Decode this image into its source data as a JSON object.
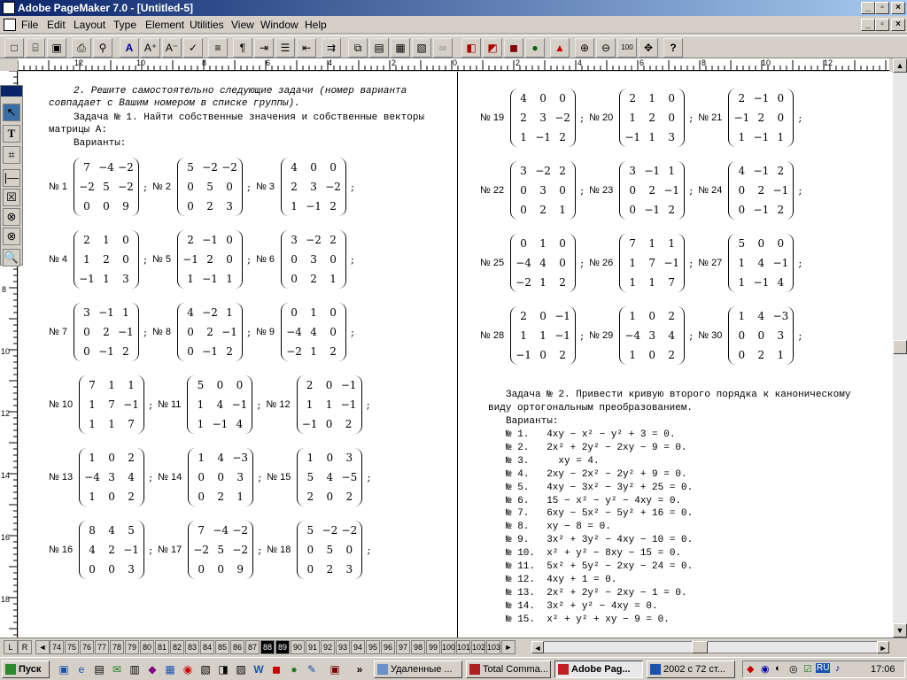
{
  "window": {
    "title": "Adobe PageMaker 7.0 - [Untitled-5]"
  },
  "menu": [
    "File",
    "Edit",
    "Layout",
    "Type",
    "Element",
    "Utilities",
    "View",
    "Window",
    "Help"
  ],
  "ruler": {
    "top_labels": [
      "12",
      "10",
      "8",
      "6",
      "4",
      "2",
      "0",
      "2",
      "4",
      "6",
      "8",
      "10",
      "12"
    ],
    "left_labels": [
      "8",
      "10",
      "12",
      "14",
      "16",
      "18"
    ]
  },
  "left_col": {
    "intro": [
      "2. Решите самостоятельно следующие задачи (номер варианта",
      "совпадает с Вашим номером в списке группы)."
    ],
    "task1": [
      "Задача № 1. Найти собственные значения и собственные векторы",
      "матрицы A:"
    ],
    "variants_label": "Варианты:",
    "rows": [
      {
        "items": [
          {
            "label": "№ 1",
            "m": [
              [
                "7",
                "−4",
                "−2"
              ],
              [
                "−2",
                "5",
                "−2"
              ],
              [
                "0",
                "0",
                "9"
              ]
            ]
          },
          {
            "label": "№ 2",
            "m": [
              [
                "5",
                "−2",
                "−2"
              ],
              [
                "0",
                "5",
                "0"
              ],
              [
                "0",
                "2",
                "3"
              ]
            ]
          },
          {
            "label": "№ 3",
            "m": [
              [
                "4",
                "0",
                "0"
              ],
              [
                "2",
                "3",
                "−2"
              ],
              [
                "1",
                "−1",
                "2"
              ]
            ]
          }
        ]
      },
      {
        "items": [
          {
            "label": "№ 4",
            "m": [
              [
                "2",
                "1",
                "0"
              ],
              [
                "1",
                "2",
                "0"
              ],
              [
                "−1",
                "1",
                "3"
              ]
            ]
          },
          {
            "label": "№ 5",
            "m": [
              [
                "2",
                "−1",
                "0"
              ],
              [
                "−1",
                "2",
                "0"
              ],
              [
                "1",
                "−1",
                "1"
              ]
            ]
          },
          {
            "label": "№ 6",
            "m": [
              [
                "3",
                "−2",
                "2"
              ],
              [
                "0",
                "3",
                "0"
              ],
              [
                "0",
                "2",
                "1"
              ]
            ]
          }
        ]
      },
      {
        "items": [
          {
            "label": "№ 7",
            "m": [
              [
                "3",
                "−1",
                "1"
              ],
              [
                "0",
                "2",
                "−1"
              ],
              [
                "0",
                "−1",
                "2"
              ]
            ]
          },
          {
            "label": "№ 8",
            "m": [
              [
                "4",
                "−2",
                "1"
              ],
              [
                "0",
                "2",
                "−1"
              ],
              [
                "0",
                "−1",
                "2"
              ]
            ]
          },
          {
            "label": "№ 9",
            "m": [
              [
                "0",
                "1",
                "0"
              ],
              [
                "−4",
                "4",
                "0"
              ],
              [
                "−2",
                "1",
                "2"
              ]
            ]
          }
        ]
      },
      {
        "items": [
          {
            "label": "№ 10",
            "m": [
              [
                "7",
                "1",
                "1"
              ],
              [
                "1",
                "7",
                "−1"
              ],
              [
                "1",
                "1",
                "7"
              ]
            ]
          },
          {
            "label": "№ 11",
            "m": [
              [
                "5",
                "0",
                "0"
              ],
              [
                "1",
                "4",
                "−1"
              ],
              [
                "1",
                "−1",
                "4"
              ]
            ]
          },
          {
            "label": "№ 12",
            "m": [
              [
                "2",
                "0",
                "−1"
              ],
              [
                "1",
                "1",
                "−1"
              ],
              [
                "−1",
                "0",
                "2"
              ]
            ]
          }
        ]
      },
      {
        "items": [
          {
            "label": "№ 13",
            "m": [
              [
                "1",
                "0",
                "2"
              ],
              [
                "−4",
                "3",
                "4"
              ],
              [
                "1",
                "0",
                "2"
              ]
            ]
          },
          {
            "label": "№ 14",
            "m": [
              [
                "1",
                "4",
                "−3"
              ],
              [
                "0",
                "0",
                "3"
              ],
              [
                "0",
                "2",
                "1"
              ]
            ]
          },
          {
            "label": "№ 15",
            "m": [
              [
                "1",
                "0",
                "3"
              ],
              [
                "5",
                "4",
                "−5"
              ],
              [
                "2",
                "0",
                "2"
              ]
            ]
          }
        ]
      },
      {
        "items": [
          {
            "label": "№ 16",
            "m": [
              [
                "8",
                "4",
                "5"
              ],
              [
                "4",
                "2",
                "−1"
              ],
              [
                "0",
                "0",
                "3"
              ]
            ]
          },
          {
            "label": "№ 17",
            "m": [
              [
                "7",
                "−4",
                "−2"
              ],
              [
                "−2",
                "5",
                "−2"
              ],
              [
                "0",
                "0",
                "9"
              ]
            ]
          },
          {
            "label": "№ 18",
            "m": [
              [
                "5",
                "−2",
                "−2"
              ],
              [
                "0",
                "5",
                "0"
              ],
              [
                "0",
                "2",
                "3"
              ]
            ]
          }
        ]
      }
    ]
  },
  "right_col": {
    "rows": [
      {
        "items": [
          {
            "label": "№ 19",
            "m": [
              [
                "4",
                "0",
                "0"
              ],
              [
                "2",
                "3",
                "−2"
              ],
              [
                "1",
                "−1",
                "2"
              ]
            ]
          },
          {
            "label": "№ 20",
            "m": [
              [
                "2",
                "1",
                "0"
              ],
              [
                "1",
                "2",
                "0"
              ],
              [
                "−1",
                "1",
                "3"
              ]
            ]
          },
          {
            "label": "№ 21",
            "m": [
              [
                "2",
                "−1",
                "0"
              ],
              [
                "−1",
                "2",
                "0"
              ],
              [
                "1",
                "−1",
                "1"
              ]
            ]
          }
        ]
      },
      {
        "items": [
          {
            "label": "№ 22",
            "m": [
              [
                "3",
                "−2",
                "2"
              ],
              [
                "0",
                "3",
                "0"
              ],
              [
                "0",
                "2",
                "1"
              ]
            ]
          },
          {
            "label": "№ 23",
            "m": [
              [
                "3",
                "−1",
                "1"
              ],
              [
                "0",
                "2",
                "−1"
              ],
              [
                "0",
                "−1",
                "2"
              ]
            ]
          },
          {
            "label": "№ 24",
            "m": [
              [
                "4",
                "−1",
                "2"
              ],
              [
                "0",
                "2",
                "−1"
              ],
              [
                "0",
                "−1",
                "2"
              ]
            ]
          }
        ]
      },
      {
        "items": [
          {
            "label": "№ 25",
            "m": [
              [
                "0",
                "1",
                "0"
              ],
              [
                "−4",
                "4",
                "0"
              ],
              [
                "−2",
                "1",
                "2"
              ]
            ]
          },
          {
            "label": "№ 26",
            "m": [
              [
                "7",
                "1",
                "1"
              ],
              [
                "1",
                "7",
                "−1"
              ],
              [
                "1",
                "1",
                "7"
              ]
            ]
          },
          {
            "label": "№ 27",
            "m": [
              [
                "5",
                "0",
                "0"
              ],
              [
                "1",
                "4",
                "−1"
              ],
              [
                "1",
                "−1",
                "4"
              ]
            ]
          }
        ]
      },
      {
        "items": [
          {
            "label": "№ 28",
            "m": [
              [
                "2",
                "0",
                "−1"
              ],
              [
                "1",
                "1",
                "−1"
              ],
              [
                "−1",
                "0",
                "2"
              ]
            ]
          },
          {
            "label": "№ 29",
            "m": [
              [
                "1",
                "0",
                "2"
              ],
              [
                "−4",
                "3",
                "4"
              ],
              [
                "1",
                "0",
                "2"
              ]
            ]
          },
          {
            "label": "№ 30",
            "m": [
              [
                "1",
                "4",
                "−3"
              ],
              [
                "0",
                "0",
                "3"
              ],
              [
                "0",
                "2",
                "1"
              ]
            ]
          }
        ]
      }
    ],
    "task2": [
      "Задача № 2. Привести кривую второго порядка к каноническому",
      "виду ортогональным преобразованием."
    ],
    "variants_label": "Варианты:",
    "equations": [
      "№ 1.   4xy − x² − y² + 3 = 0.",
      "№ 2.   2x² + 2y² − 2xy − 9 = 0.",
      "№ 3.     xy = 4.",
      "№ 4.   2xy − 2x² − 2y² + 9 = 0.",
      "№ 5.   4xy − 3x² − 3y² + 25 = 0.",
      "№ 6.   15 − x² − y² − 4xy = 0.",
      "№ 7.   6xy − 5x² − 5y² + 16 = 0.",
      "№ 8.   xy − 8 = 0.",
      "№ 9.   3x² + 3y² − 4xy − 10 = 0.",
      "№ 10.  x² + y² − 8xy − 15 = 0.",
      "№ 11.  5x² + 5y² − 2xy − 24 = 0.",
      "№ 12.  4xy + 1 = 0.",
      "№ 13.  2x² + 2y² − 2xy − 1 = 0.",
      "№ 14.  3x² + y² − 4xy = 0.",
      "№ 15.  x² + y² + xy − 9 = 0."
    ]
  },
  "page_tabs": {
    "lr": [
      "L",
      "R"
    ],
    "pages": [
      "74",
      "75",
      "76",
      "77",
      "78",
      "79",
      "80",
      "81",
      "82",
      "83",
      "84",
      "85",
      "86",
      "87",
      "88",
      "89",
      "90",
      "91",
      "92",
      "93",
      "94",
      "95",
      "96",
      "97",
      "98",
      "99",
      "100",
      "101",
      "102",
      "103"
    ],
    "active": [
      "88",
      "89"
    ]
  },
  "taskbar": {
    "start": "Пуск",
    "tasks": [
      "Удаленные ...",
      "Total Comma...",
      "Adobe Pag...",
      "2002 с 72 ст..."
    ],
    "active_task": "Adobe Pag...",
    "lang": "RU",
    "clock": "17:06"
  }
}
